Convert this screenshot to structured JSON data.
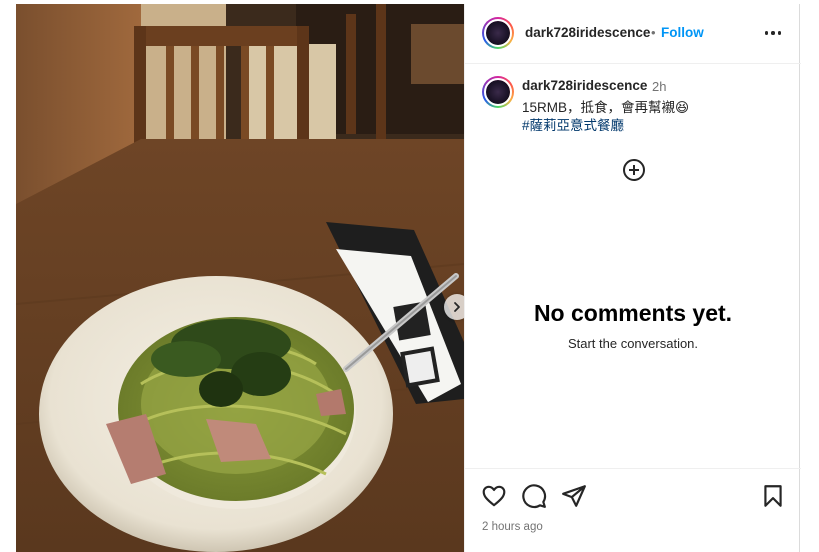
{
  "post": {
    "username": "dark728iridescence",
    "separator": "•",
    "follow_label": "Follow",
    "more_icon": "more-horizontal-icon",
    "next_icon": "chevron-right-icon"
  },
  "caption": {
    "username": "dark728iridescence",
    "time": "2h",
    "text": "15RMB，抵食，會再幫襯😆",
    "hashtag": "#薩莉亞意式餐廳"
  },
  "comments": {
    "add_icon": "add-circle-icon",
    "empty_title": "No comments yet.",
    "empty_subtitle": "Start the conversation."
  },
  "actions": {
    "like_icon": "heart-icon",
    "comment_icon": "comment-icon",
    "share_icon": "send-icon",
    "save_icon": "bookmark-icon",
    "timestamp": "2 hours ago"
  },
  "colors": {
    "follow": "#0095f6",
    "hashtag": "#00376b",
    "secondary_text": "#737373",
    "border": "#efefef"
  }
}
